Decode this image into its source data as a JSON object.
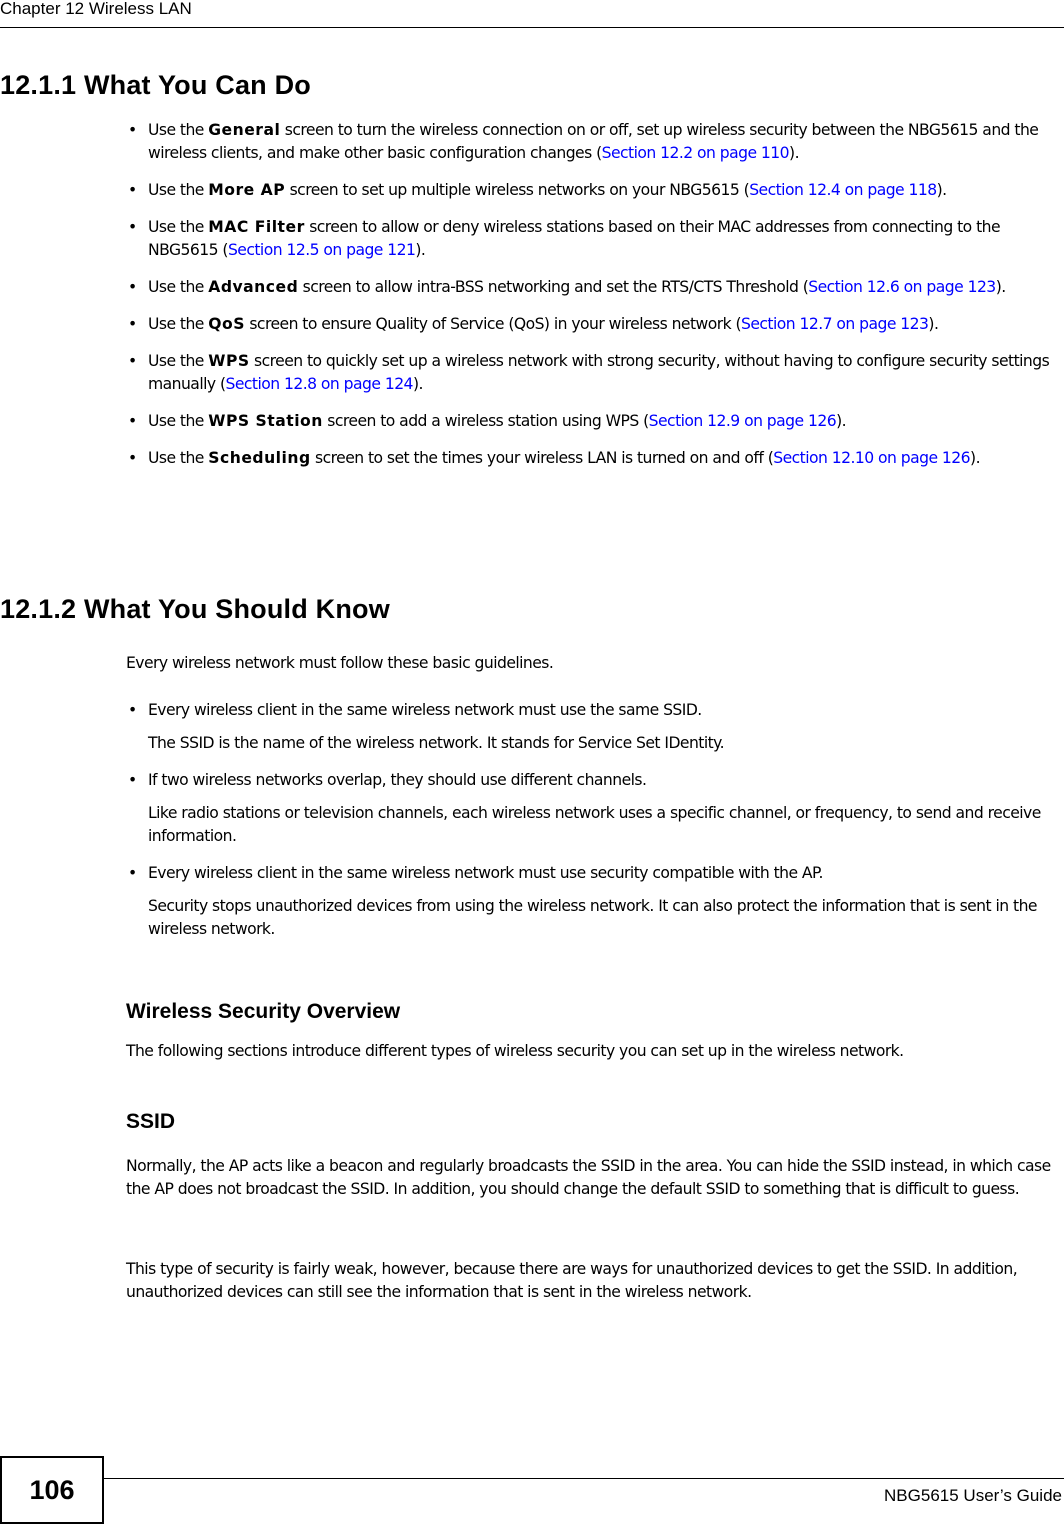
{
  "header": {
    "chapter_title": "Chapter 12 Wireless LAN"
  },
  "section_1": {
    "heading": "12.1.1  What You Can Do",
    "items": [
      {
        "pre": "Use the ",
        "bold": "General",
        "mid": " screen to turn the wireless connection on or off, set up wireless security between the NBG5615 and the wireless clients, and make other basic configuration changes (",
        "link": "Section 12.2 on page 110",
        "post": ")."
      },
      {
        "pre": "Use the ",
        "bold": "More AP",
        "mid": " screen to set up multiple wireless networks on your NBG5615 (",
        "link": "Section 12.4 on page 118",
        "post": ")."
      },
      {
        "pre": "Use the ",
        "bold": "MAC Filter",
        "mid": " screen to allow or deny wireless stations based on their MAC addresses from connecting to the NBG5615 (",
        "link": "Section 12.5 on page 121",
        "post": ")."
      },
      {
        "pre": "Use the ",
        "bold": "Advanced",
        "mid": " screen to allow intra-BSS networking and set the RTS/CTS Threshold (",
        "link": "Section 12.6 on page 123",
        "post": ")."
      },
      {
        "pre": "Use the ",
        "bold": "QoS",
        "mid": " screen to ensure Quality of Service (QoS) in your wireless network (",
        "link": "Section 12.7 on page 123",
        "post": ")."
      },
      {
        "pre": "Use the ",
        "bold": "WPS",
        "mid": " screen to quickly set up a wireless network with strong security, without having to configure security settings manually (",
        "link": "Section 12.8 on page 124",
        "post": ")."
      },
      {
        "pre": "Use the ",
        "bold": "WPS Station",
        "mid": " screen to add a wireless station using WPS (",
        "link": "Section 12.9 on page 126",
        "post": ")."
      },
      {
        "pre": "Use the ",
        "bold": "Scheduling",
        "mid": " screen to set the times your wireless LAN is turned on and off (",
        "link": "Section 12.10 on page 126",
        "post": ")."
      }
    ]
  },
  "section_2": {
    "heading": "12.1.2  What You Should Know",
    "intro": "Every wireless network must follow these basic guidelines.",
    "items": [
      {
        "main": "Every wireless client in the same wireless network must use the same SSID.",
        "sub": "The SSID is the name of the wireless network. It stands for Service Set IDentity."
      },
      {
        "main": "If two wireless networks overlap, they should use different channels.",
        "sub": "Like radio stations or television channels, each wireless network uses a specific channel, or frequency, to send and receive information."
      },
      {
        "main": "Every wireless client in the same wireless network must use security compatible with the AP.",
        "sub": "Security stops unauthorized devices from using the wireless network. It can also protect the information that is sent in the wireless network."
      }
    ]
  },
  "wireless_security": {
    "heading": "Wireless Security Overview",
    "text": "The following sections introduce different types of wireless security you can set up in the wireless network."
  },
  "ssid": {
    "heading": "SSID",
    "para1": "Normally, the AP acts like a beacon and regularly broadcasts the SSID in the area. You can hide the SSID instead, in which case the AP does not broadcast the SSID. In addition, you should change the default SSID to something that is difficult to guess.",
    "para2": "This type of security is fairly weak, however, because there are ways for unauthorized devices to get the SSID. In addition, unauthorized devices can still see the information that is sent in the wireless network."
  },
  "footer": {
    "page_number": "106",
    "guide_title": "NBG5615 User’s Guide"
  },
  "colors": {
    "link": "#0000ff",
    "text": "#000000"
  }
}
